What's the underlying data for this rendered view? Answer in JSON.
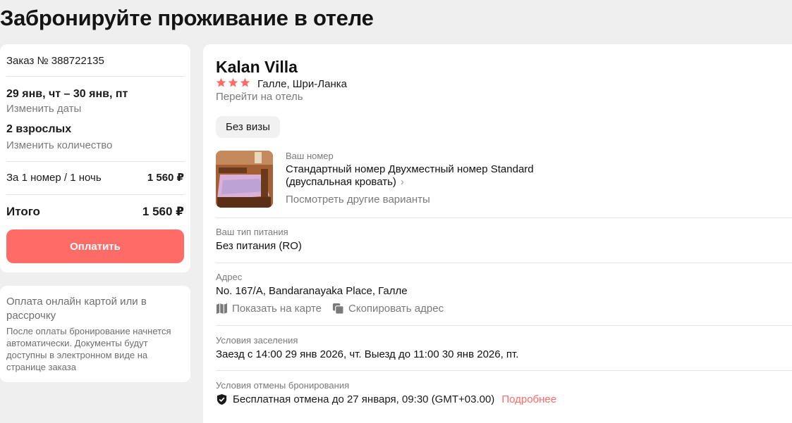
{
  "page": {
    "title": "Забронируйте проживание в отеле"
  },
  "order": {
    "number_label": "Заказ № 388722135",
    "dates": "29 янв, чт – 30 янв, пт",
    "change_dates": "Изменить даты",
    "guests": "2 взрослых",
    "change_qty": "Изменить количество",
    "per_night_label": "За 1 номер / 1 ночь",
    "per_night_price": "1 560 ₽",
    "total_label": "Итого",
    "total_price": "1 560 ₽",
    "pay_button": "Оплатить"
  },
  "payment_info": {
    "title": "Оплата онлайн картой или в рассрочку",
    "text": "После оплаты бронирование начнется автоматически. Документы будут доступны в электронном виде на странице заказа"
  },
  "hotel": {
    "name": "Kalan Villa",
    "stars": 3,
    "location": "Галле, Шри-Ланка",
    "goto_link": "Перейти на отель",
    "visa_chip": "Без визы",
    "room_label": "Ваш номер",
    "room_name": "Стандартный номер Двухместный номер Standard (двуспальная кровать)",
    "other_options": "Посмотреть другие варианты",
    "meal_label": "Ваш тип питания",
    "meal_value": "Без питания (RO)",
    "address_label": "Адрес",
    "address_value": "No. 167/A, Bandaranayaka Place, Галле",
    "show_map": "Показать на карте",
    "copy_address": "Скопировать адрес",
    "checkin_label": "Условия заселения",
    "checkin_value": "Заезд с 14:00 29 янв 2026, чт. Выезд до 11:00 30 янв 2026, пт.",
    "cancel_label": "Условия отмены бронирования",
    "cancel_value": "Бесплатная отмена до 27 января, 09:30 (GMT+03.00)",
    "cancel_more": "Подробнее"
  },
  "colors": {
    "accent": "#ff6b66",
    "muted": "#7a7a7a",
    "background": "#efefef"
  },
  "icons": [
    "star-icon",
    "chevron-right-icon",
    "map-icon",
    "copy-icon",
    "shield-check-icon"
  ]
}
